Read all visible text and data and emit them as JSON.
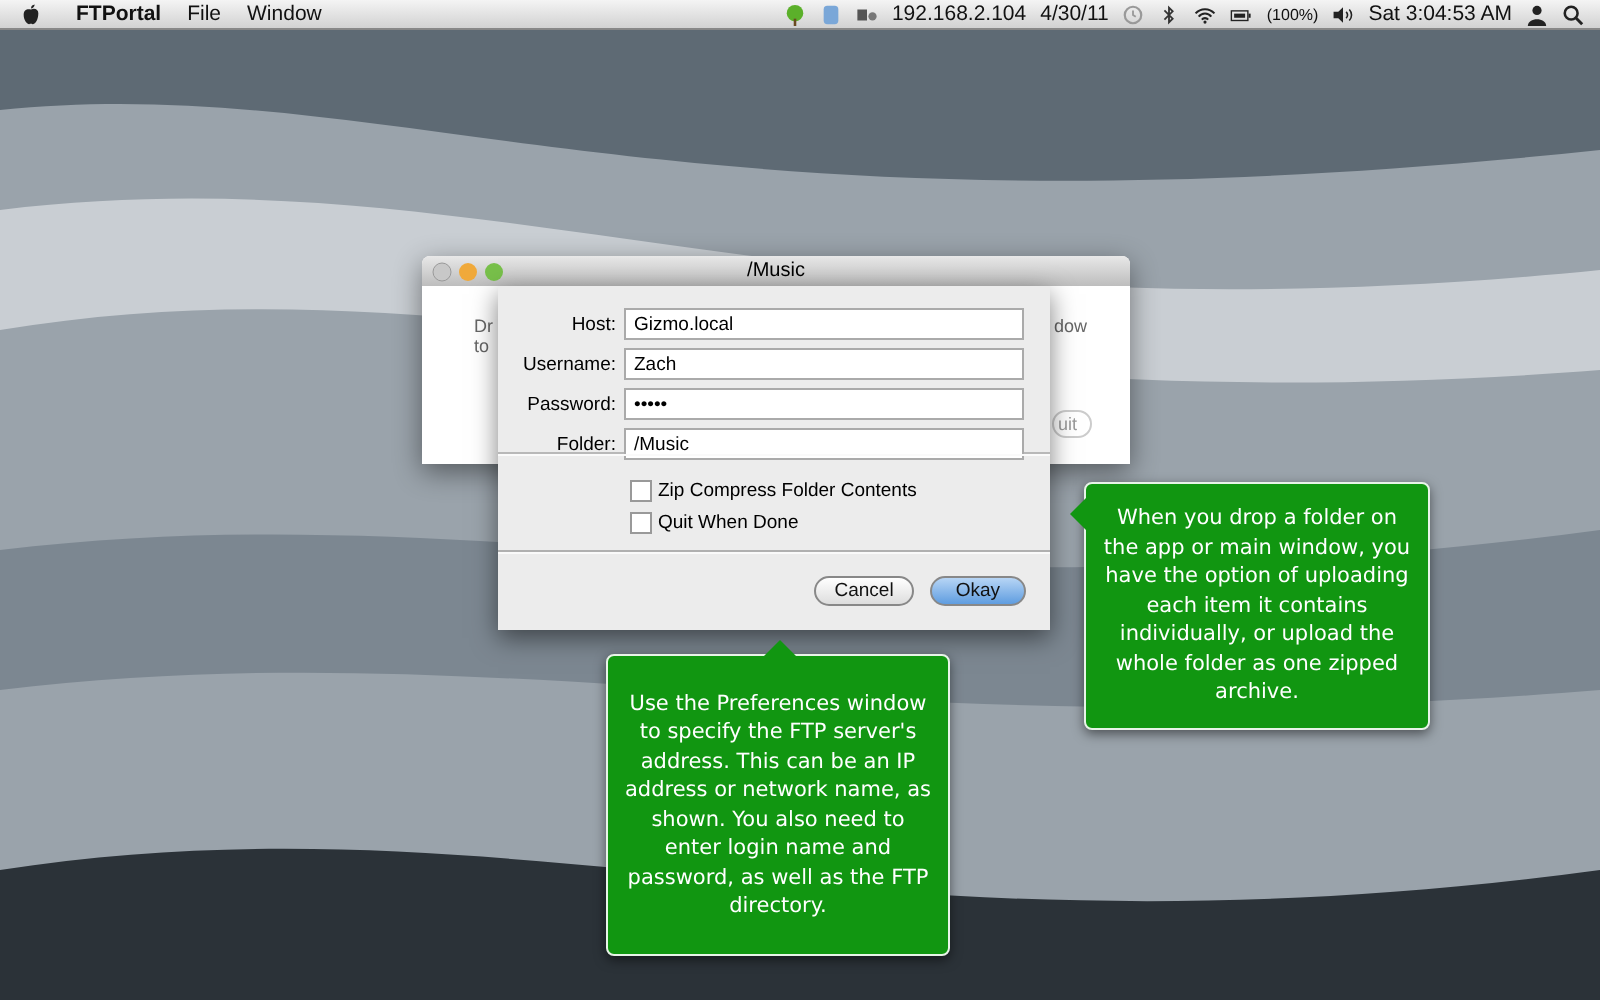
{
  "menu_bar": {
    "app_name": "FTPortal",
    "menus": [
      "File",
      "Window"
    ],
    "ip_address": "192.168.2.104",
    "date": "4/30/11",
    "battery": "(100%)",
    "clock": "Sat 3:04:53 AM"
  },
  "main_window": {
    "title": "/Music",
    "text_fragments": [
      "Dr",
      "to",
      "dow"
    ],
    "button_fragment": "uit"
  },
  "preferences_sheet": {
    "fields": [
      {
        "label": "Host:",
        "value": "Gizmo.local"
      },
      {
        "label": "Username:",
        "value": "Zach"
      },
      {
        "label": "Password:",
        "value": "•••••"
      },
      {
        "label": "Folder:",
        "value": "/Music"
      }
    ],
    "options": [
      {
        "label": "Zip Compress Folder Contents",
        "checked": false
      },
      {
        "label": "Quit When Done",
        "checked": false
      }
    ],
    "buttons": [
      {
        "label": "Cancel",
        "kind": "plain"
      },
      {
        "label": "Okay",
        "kind": "default"
      }
    ]
  },
  "callouts": [
    {
      "text": "Use the Preferences window to specify the FTP server's address. This can be an IP address or network name, as shown. You also need to enter login name and password, as well as the FTP directory.",
      "kind": "below"
    },
    {
      "text": "When you drop a folder on the app or main window, you have the option of uploading each item it contains individually, or upload the whole folder as one zipped archive.",
      "kind": "beside"
    }
  ]
}
